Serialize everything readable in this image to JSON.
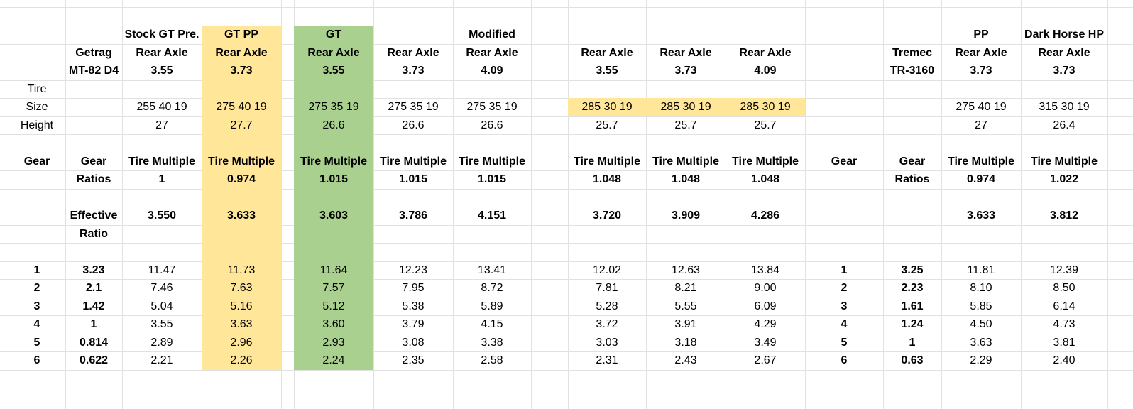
{
  "colors": {
    "yellow": "#ffe699",
    "green": "#a9d08e",
    "grid": "#e1e1e1"
  },
  "rows": [
    [
      {
        "c": 2,
        "t": "Stock GT Pre.",
        "b": true
      },
      {
        "c": 3,
        "t": "GT PP",
        "b": true
      },
      {
        "c": 5,
        "t": "GT",
        "b": true
      },
      {
        "c": 7,
        "t": "Modified",
        "b": true
      },
      {
        "c": 14,
        "t": "PP",
        "b": true
      },
      {
        "c": 15,
        "t": "Dark Horse HP",
        "b": true
      }
    ],
    [
      {
        "c": 1,
        "t": "Getrag",
        "b": true
      },
      {
        "c": 2,
        "t": "Rear Axle",
        "b": true
      },
      {
        "c": 3,
        "t": "Rear Axle",
        "b": true
      },
      {
        "c": 5,
        "t": "Rear Axle",
        "b": true
      },
      {
        "c": 6,
        "t": "Rear Axle",
        "b": true
      },
      {
        "c": 7,
        "t": "Rear Axle",
        "b": true
      },
      {
        "c": 9,
        "t": "Rear Axle",
        "b": true
      },
      {
        "c": 10,
        "t": "Rear Axle",
        "b": true
      },
      {
        "c": 11,
        "t": "Rear Axle",
        "b": true
      },
      {
        "c": 13,
        "t": "Tremec",
        "b": true
      },
      {
        "c": 14,
        "t": "Rear Axle",
        "b": true
      },
      {
        "c": 15,
        "t": "Rear Axle",
        "b": true
      }
    ],
    [
      {
        "c": 1,
        "t": "MT-82 D4",
        "b": true
      },
      {
        "c": 2,
        "t": "3.55",
        "b": true
      },
      {
        "c": 3,
        "t": "3.73",
        "b": true
      },
      {
        "c": 5,
        "t": "3.55",
        "b": true
      },
      {
        "c": 6,
        "t": "3.73",
        "b": true
      },
      {
        "c": 7,
        "t": "4.09",
        "b": true
      },
      {
        "c": 9,
        "t": "3.55",
        "b": true
      },
      {
        "c": 10,
        "t": "3.73",
        "b": true
      },
      {
        "c": 11,
        "t": "4.09",
        "b": true
      },
      {
        "c": 13,
        "t": "TR-3160",
        "b": true
      },
      {
        "c": 14,
        "t": "3.73",
        "b": true
      },
      {
        "c": 15,
        "t": "3.73",
        "b": true
      }
    ],
    [
      {
        "c": 0,
        "t": "Tire",
        "b": false
      }
    ],
    [
      {
        "c": 0,
        "t": "Size",
        "b": false
      },
      {
        "c": 2,
        "t": "255 40 19",
        "b": false
      },
      {
        "c": 3,
        "t": "275 40 19",
        "b": false
      },
      {
        "c": 5,
        "t": "275 35 19",
        "b": false
      },
      {
        "c": 6,
        "t": "275 35 19",
        "b": false
      },
      {
        "c": 7,
        "t": "275 35 19",
        "b": false
      },
      {
        "c": 9,
        "t": "285 30 19",
        "b": false
      },
      {
        "c": 10,
        "t": "285 30 19",
        "b": false
      },
      {
        "c": 11,
        "t": "285 30 19",
        "b": false
      },
      {
        "c": 14,
        "t": "275 40 19",
        "b": false
      },
      {
        "c": 15,
        "t": "315 30 19",
        "b": false
      }
    ],
    [
      {
        "c": 0,
        "t": "Height",
        "b": false
      },
      {
        "c": 2,
        "t": "27",
        "b": false
      },
      {
        "c": 3,
        "t": "27.7",
        "b": false
      },
      {
        "c": 5,
        "t": "26.6",
        "b": false
      },
      {
        "c": 6,
        "t": "26.6",
        "b": false
      },
      {
        "c": 7,
        "t": "26.6",
        "b": false
      },
      {
        "c": 9,
        "t": "25.7",
        "b": false
      },
      {
        "c": 10,
        "t": "25.7",
        "b": false
      },
      {
        "c": 11,
        "t": "25.7",
        "b": false
      },
      {
        "c": 14,
        "t": "27",
        "b": false
      },
      {
        "c": 15,
        "t": "26.4",
        "b": false
      }
    ],
    [],
    [
      {
        "c": 0,
        "t": "Gear",
        "b": true
      },
      {
        "c": 1,
        "t": "Gear",
        "b": true
      },
      {
        "c": 2,
        "t": "Tire Multiple",
        "b": true
      },
      {
        "c": 3,
        "t": "Tire Multiple",
        "b": true
      },
      {
        "c": 5,
        "t": "Tire Multiple",
        "b": true
      },
      {
        "c": 6,
        "t": "Tire Multiple",
        "b": true
      },
      {
        "c": 7,
        "t": "Tire Multiple",
        "b": true
      },
      {
        "c": 9,
        "t": "Tire Multiple",
        "b": true
      },
      {
        "c": 10,
        "t": "Tire Multiple",
        "b": true
      },
      {
        "c": 11,
        "t": "Tire Multiple",
        "b": true
      },
      {
        "c": 12,
        "t": "Gear",
        "b": true
      },
      {
        "c": 13,
        "t": "Gear",
        "b": true
      },
      {
        "c": 14,
        "t": "Tire Multiple",
        "b": true
      },
      {
        "c": 15,
        "t": "Tire Multiple",
        "b": true
      }
    ],
    [
      {
        "c": 1,
        "t": "Ratios",
        "b": true
      },
      {
        "c": 2,
        "t": "1",
        "b": true
      },
      {
        "c": 3,
        "t": "0.974",
        "b": true
      },
      {
        "c": 5,
        "t": "1.015",
        "b": true
      },
      {
        "c": 6,
        "t": "1.015",
        "b": true
      },
      {
        "c": 7,
        "t": "1.015",
        "b": true
      },
      {
        "c": 9,
        "t": "1.048",
        "b": true
      },
      {
        "c": 10,
        "t": "1.048",
        "b": true
      },
      {
        "c": 11,
        "t": "1.048",
        "b": true
      },
      {
        "c": 13,
        "t": "Ratios",
        "b": true
      },
      {
        "c": 14,
        "t": "0.974",
        "b": true
      },
      {
        "c": 15,
        "t": "1.022",
        "b": true
      }
    ],
    [],
    [
      {
        "c": 1,
        "t": "Effective",
        "b": true
      },
      {
        "c": 2,
        "t": "3.550",
        "b": true
      },
      {
        "c": 3,
        "t": "3.633",
        "b": true
      },
      {
        "c": 5,
        "t": "3.603",
        "b": true
      },
      {
        "c": 6,
        "t": "3.786",
        "b": true
      },
      {
        "c": 7,
        "t": "4.151",
        "b": true
      },
      {
        "c": 9,
        "t": "3.720",
        "b": true
      },
      {
        "c": 10,
        "t": "3.909",
        "b": true
      },
      {
        "c": 11,
        "t": "4.286",
        "b": true
      },
      {
        "c": 14,
        "t": "3.633",
        "b": true
      },
      {
        "c": 15,
        "t": "3.812",
        "b": true
      }
    ],
    [
      {
        "c": 1,
        "t": "Ratio",
        "b": true
      }
    ],
    [],
    [
      {
        "c": 0,
        "t": "1",
        "b": true
      },
      {
        "c": 1,
        "t": "3.23",
        "b": true
      },
      {
        "c": 2,
        "t": "11.47",
        "b": false
      },
      {
        "c": 3,
        "t": "11.73",
        "b": false
      },
      {
        "c": 5,
        "t": "11.64",
        "b": false
      },
      {
        "c": 6,
        "t": "12.23",
        "b": false
      },
      {
        "c": 7,
        "t": "13.41",
        "b": false
      },
      {
        "c": 9,
        "t": "12.02",
        "b": false
      },
      {
        "c": 10,
        "t": "12.63",
        "b": false
      },
      {
        "c": 11,
        "t": "13.84",
        "b": false
      },
      {
        "c": 12,
        "t": "1",
        "b": true
      },
      {
        "c": 13,
        "t": "3.25",
        "b": true
      },
      {
        "c": 14,
        "t": "11.81",
        "b": false
      },
      {
        "c": 15,
        "t": "12.39",
        "b": false
      }
    ],
    [
      {
        "c": 0,
        "t": "2",
        "b": true
      },
      {
        "c": 1,
        "t": "2.1",
        "b": true
      },
      {
        "c": 2,
        "t": "7.46",
        "b": false
      },
      {
        "c": 3,
        "t": "7.63",
        "b": false
      },
      {
        "c": 5,
        "t": "7.57",
        "b": false
      },
      {
        "c": 6,
        "t": "7.95",
        "b": false
      },
      {
        "c": 7,
        "t": "8.72",
        "b": false
      },
      {
        "c": 9,
        "t": "7.81",
        "b": false
      },
      {
        "c": 10,
        "t": "8.21",
        "b": false
      },
      {
        "c": 11,
        "t": "9.00",
        "b": false
      },
      {
        "c": 12,
        "t": "2",
        "b": true
      },
      {
        "c": 13,
        "t": "2.23",
        "b": true
      },
      {
        "c": 14,
        "t": "8.10",
        "b": false
      },
      {
        "c": 15,
        "t": "8.50",
        "b": false
      }
    ],
    [
      {
        "c": 0,
        "t": "3",
        "b": true
      },
      {
        "c": 1,
        "t": "1.42",
        "b": true
      },
      {
        "c": 2,
        "t": "5.04",
        "b": false
      },
      {
        "c": 3,
        "t": "5.16",
        "b": false
      },
      {
        "c": 5,
        "t": "5.12",
        "b": false
      },
      {
        "c": 6,
        "t": "5.38",
        "b": false
      },
      {
        "c": 7,
        "t": "5.89",
        "b": false
      },
      {
        "c": 9,
        "t": "5.28",
        "b": false
      },
      {
        "c": 10,
        "t": "5.55",
        "b": false
      },
      {
        "c": 11,
        "t": "6.09",
        "b": false
      },
      {
        "c": 12,
        "t": "3",
        "b": true
      },
      {
        "c": 13,
        "t": "1.61",
        "b": true
      },
      {
        "c": 14,
        "t": "5.85",
        "b": false
      },
      {
        "c": 15,
        "t": "6.14",
        "b": false
      }
    ],
    [
      {
        "c": 0,
        "t": "4",
        "b": true
      },
      {
        "c": 1,
        "t": "1",
        "b": true
      },
      {
        "c": 2,
        "t": "3.55",
        "b": false
      },
      {
        "c": 3,
        "t": "3.63",
        "b": false
      },
      {
        "c": 5,
        "t": "3.60",
        "b": false
      },
      {
        "c": 6,
        "t": "3.79",
        "b": false
      },
      {
        "c": 7,
        "t": "4.15",
        "b": false
      },
      {
        "c": 9,
        "t": "3.72",
        "b": false
      },
      {
        "c": 10,
        "t": "3.91",
        "b": false
      },
      {
        "c": 11,
        "t": "4.29",
        "b": false
      },
      {
        "c": 12,
        "t": "4",
        "b": true
      },
      {
        "c": 13,
        "t": "1.24",
        "b": true
      },
      {
        "c": 14,
        "t": "4.50",
        "b": false
      },
      {
        "c": 15,
        "t": "4.73",
        "b": false
      }
    ],
    [
      {
        "c": 0,
        "t": "5",
        "b": true
      },
      {
        "c": 1,
        "t": "0.814",
        "b": true
      },
      {
        "c": 2,
        "t": "2.89",
        "b": false
      },
      {
        "c": 3,
        "t": "2.96",
        "b": false
      },
      {
        "c": 5,
        "t": "2.93",
        "b": false
      },
      {
        "c": 6,
        "t": "3.08",
        "b": false
      },
      {
        "c": 7,
        "t": "3.38",
        "b": false
      },
      {
        "c": 9,
        "t": "3.03",
        "b": false
      },
      {
        "c": 10,
        "t": "3.18",
        "b": false
      },
      {
        "c": 11,
        "t": "3.49",
        "b": false
      },
      {
        "c": 12,
        "t": "5",
        "b": true
      },
      {
        "c": 13,
        "t": "1",
        "b": true
      },
      {
        "c": 14,
        "t": "3.63",
        "b": false
      },
      {
        "c": 15,
        "t": "3.81",
        "b": false
      }
    ],
    [
      {
        "c": 0,
        "t": "6",
        "b": true
      },
      {
        "c": 1,
        "t": "0.622",
        "b": true
      },
      {
        "c": 2,
        "t": "2.21",
        "b": false
      },
      {
        "c": 3,
        "t": "2.26",
        "b": false
      },
      {
        "c": 5,
        "t": "2.24",
        "b": false
      },
      {
        "c": 6,
        "t": "2.35",
        "b": false
      },
      {
        "c": 7,
        "t": "2.58",
        "b": false
      },
      {
        "c": 9,
        "t": "2.31",
        "b": false
      },
      {
        "c": 10,
        "t": "2.43",
        "b": false
      },
      {
        "c": 11,
        "t": "2.67",
        "b": false
      },
      {
        "c": 12,
        "t": "6",
        "b": true
      },
      {
        "c": 13,
        "t": "0.63",
        "b": true
      },
      {
        "c": 14,
        "t": "2.29",
        "b": false
      },
      {
        "c": 15,
        "t": "2.40",
        "b": false
      }
    ]
  ]
}
